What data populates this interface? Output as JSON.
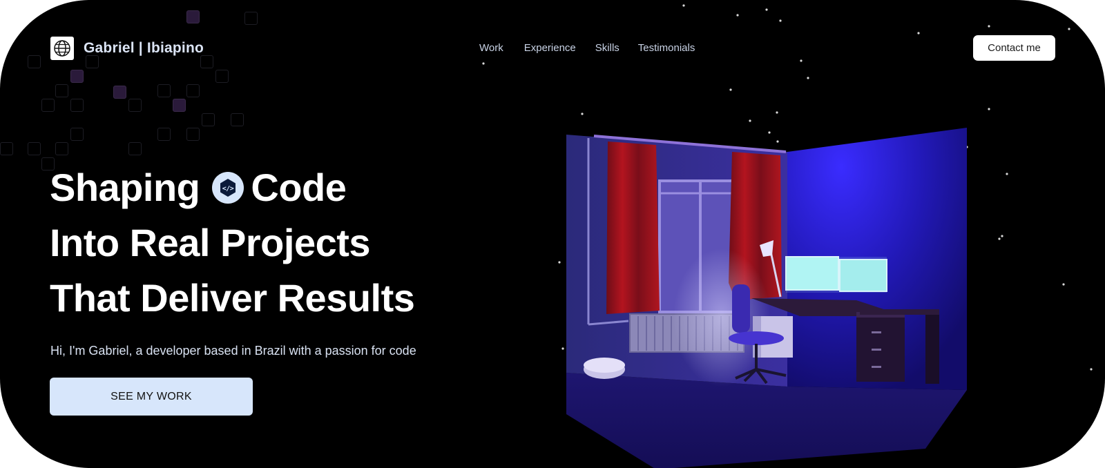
{
  "header": {
    "logo_icon": "globe-icon",
    "logo_text": "Gabriel | Ibiapino",
    "nav": [
      "Work",
      "Experience",
      "Skills",
      "Testimonials"
    ],
    "contact_label": "Contact me"
  },
  "hero": {
    "line1_a": "Shaping",
    "line1_icon": "code-icon",
    "line1_b": "Code",
    "line2": "Into Real Projects",
    "line3": "That Deliver Results",
    "intro": "Hi, I'm Gabriel, a developer based in Brazil with a passion for code",
    "cta_label": "SEE MY WORK"
  },
  "colors": {
    "background": "#000000",
    "accent_light": "#d7e6fb",
    "room_blue": "#2a22c8",
    "curtain_red": "#a5141c",
    "monitor_glow": "#b8fff6"
  }
}
